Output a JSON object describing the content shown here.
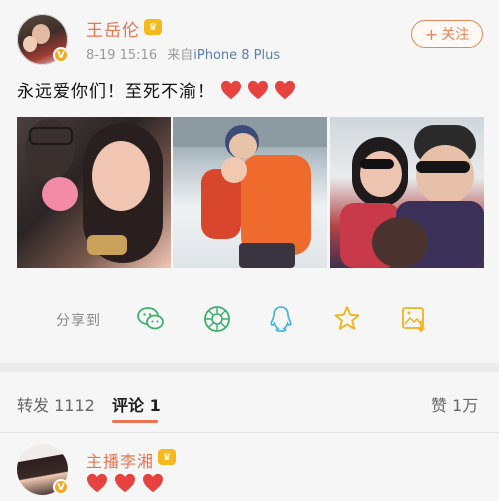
{
  "post": {
    "author": "王岳伦",
    "date": "8-19 15:16",
    "source_prefix": "来自",
    "source_device": "iPhone 8 Plus",
    "follow_label": "关注",
    "text": "永远爱你们！至死不渝！",
    "heart_count": 3,
    "heart_color": "#e64340",
    "accent_color": "#eb7350"
  },
  "share": {
    "label": "分享到",
    "icons": [
      "wechat-icon",
      "moments-icon",
      "qq-icon",
      "qzone-star-icon",
      "save-image-icon"
    ]
  },
  "tabs": {
    "repost_label": "转发 1112",
    "comment_label": "评论 1",
    "like_label": "赞 1万"
  },
  "comment": {
    "author": "主播李湘",
    "hearts": 3
  }
}
